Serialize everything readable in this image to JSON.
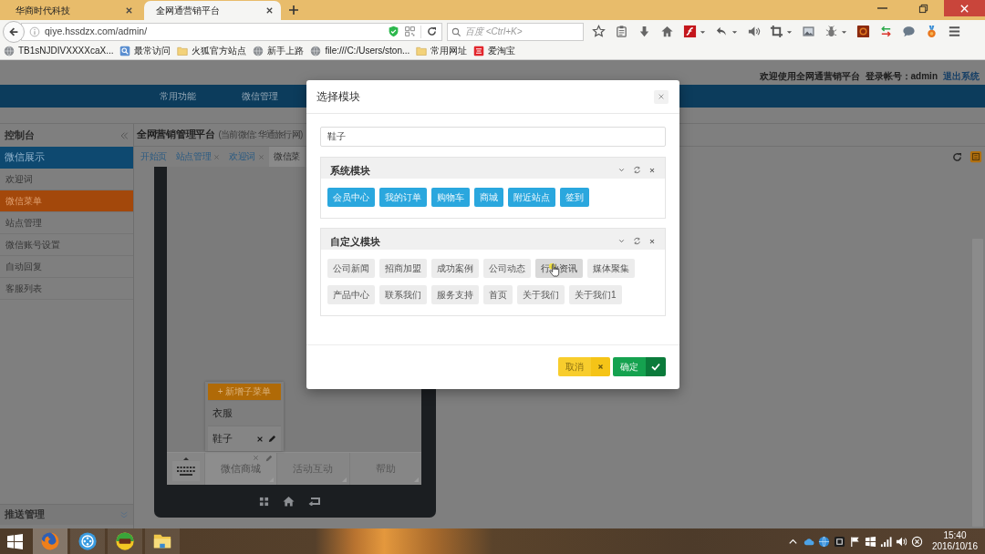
{
  "browser": {
    "tabs": [
      {
        "title": "华商时代科技",
        "selected": false
      },
      {
        "title": "全网通营销平台",
        "selected": true
      }
    ],
    "url": "qiye.hssdzx.com/admin/",
    "search": {
      "placeholder": "百度 <Ctrl+K>"
    },
    "bookmarks": [
      {
        "label": "TB1sNJDIVXXXXcaX...",
        "kind": "page"
      },
      {
        "label": "最常访问",
        "kind": "smart"
      },
      {
        "label": "火狐官方站点",
        "kind": "folder"
      },
      {
        "label": "新手上路",
        "kind": "page"
      },
      {
        "label": "file:///C:/Users/ston...",
        "kind": "page"
      },
      {
        "label": "常用网址",
        "kind": "folder"
      },
      {
        "label": "爱淘宝",
        "kind": "shop"
      }
    ]
  },
  "header": {
    "welcome": "欢迎使用全网通营销平台",
    "account": "登录帐号：admin",
    "logout": "退出系统"
  },
  "nav": [
    {
      "label": "常用功能"
    },
    {
      "label": "微信管理"
    }
  ],
  "sidebar": {
    "title": "控制台",
    "groups": [
      {
        "label": "微信展示",
        "expanded": true,
        "items": [
          {
            "label": "欢迎词",
            "selected": false
          },
          {
            "label": "微信菜单",
            "selected": true
          },
          {
            "label": "站点管理",
            "selected": false
          },
          {
            "label": "微信账号设置",
            "selected": false
          },
          {
            "label": "自动回复",
            "selected": false
          },
          {
            "label": "客服列表",
            "selected": false
          }
        ]
      },
      {
        "label": "推送管理",
        "expanded": false
      }
    ]
  },
  "main": {
    "title": "全网营销管理平台",
    "subtitle": "(当前微信: 华通旅行网)",
    "tabs": [
      {
        "label": "开始页",
        "closable": false,
        "selected": false
      },
      {
        "label": "站点管理",
        "closable": true,
        "selected": false
      },
      {
        "label": "欢迎词",
        "closable": true,
        "selected": false
      },
      {
        "label": "微信菜",
        "closable": false,
        "selected": true
      }
    ]
  },
  "phone": {
    "add_submenu": "+ 新增子菜单",
    "menu": [
      {
        "label": "微信商城",
        "selected": true,
        "children": [
          {
            "label": "衣服",
            "selected": false
          },
          {
            "label": "鞋子",
            "selected": true
          }
        ]
      },
      {
        "label": "活动互动",
        "selected": false
      },
      {
        "label": "帮助",
        "selected": false
      }
    ]
  },
  "modal": {
    "title": "选择模块",
    "name_value": "鞋子",
    "panels": [
      {
        "title": "系统模块",
        "kind": "system",
        "modules": [
          {
            "label": "会员中心",
            "hovered": false
          },
          {
            "label": "我的订单",
            "hovered": false
          },
          {
            "label": "购物车",
            "hovered": false
          },
          {
            "label": "商城",
            "hovered": false
          },
          {
            "label": "附近站点",
            "hovered": false
          },
          {
            "label": "签到",
            "hovered": false
          }
        ]
      },
      {
        "title": "自定义模块",
        "kind": "custom",
        "modules": [
          {
            "label": "公司新闻",
            "hovered": false
          },
          {
            "label": "招商加盟",
            "hovered": false
          },
          {
            "label": "成功案例",
            "hovered": false
          },
          {
            "label": "公司动态",
            "hovered": false
          },
          {
            "label": "行业资讯",
            "hovered": true
          },
          {
            "label": "媒体聚集",
            "hovered": false
          },
          {
            "label": "产品中心",
            "hovered": false
          },
          {
            "label": "联系我们",
            "hovered": false
          },
          {
            "label": "服务支持",
            "hovered": false
          },
          {
            "label": "首页",
            "hovered": false
          },
          {
            "label": "关于我们",
            "hovered": false
          },
          {
            "label": "关于我们1",
            "hovered": false
          }
        ]
      }
    ],
    "buttons": [
      {
        "label": "取消",
        "kind": "cancel"
      },
      {
        "label": "确定",
        "kind": "confirm"
      }
    ]
  },
  "taskbar": {
    "apps": [
      {
        "kind": "firefox",
        "active": true
      },
      {
        "kind": "assistant",
        "active": false
      },
      {
        "kind": "hs",
        "active": false
      },
      {
        "kind": "explorer",
        "active": false
      }
    ],
    "clock": {
      "time": "15:40",
      "date": "2016/10/16"
    }
  }
}
